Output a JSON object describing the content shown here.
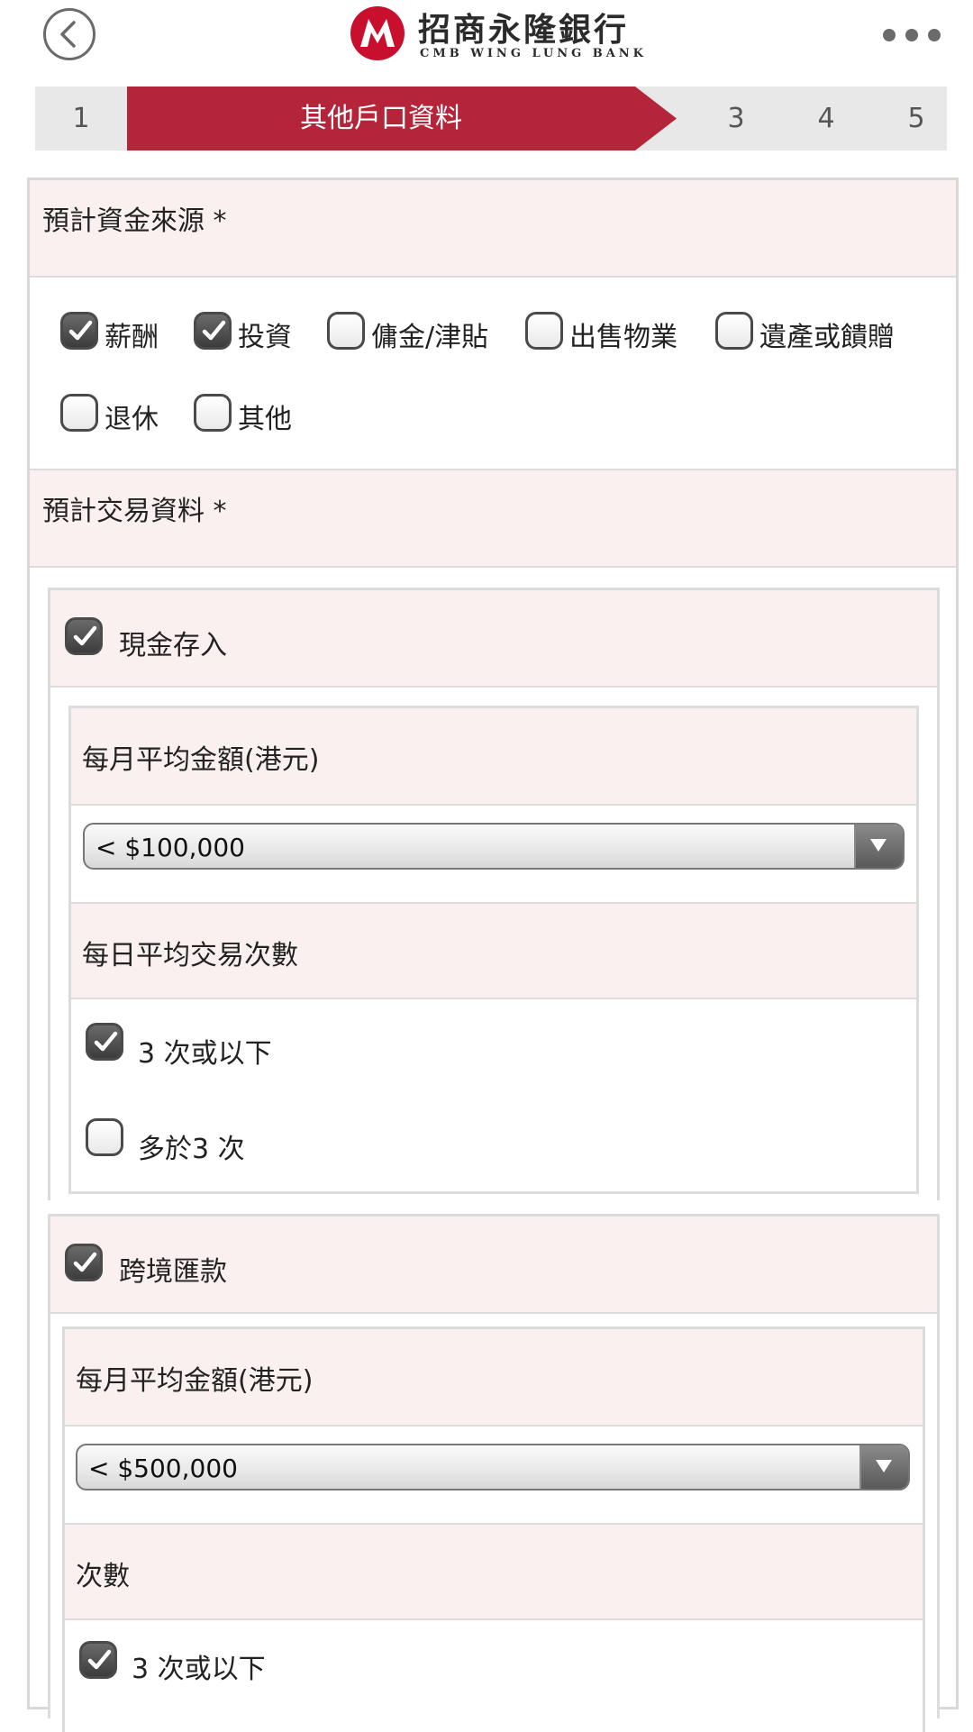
{
  "header": {
    "brand_cn": "招商永隆銀行",
    "brand_en": "CMB WING LUNG BANK",
    "brand_color": "#c8102e"
  },
  "stepper": {
    "steps": [
      "1",
      "其他戶口資料",
      "3",
      "4",
      "5"
    ],
    "current": 2,
    "active_color": "#b5253a"
  },
  "fund_source": {
    "title": "預計資金來源 *",
    "options": [
      {
        "label": "薪酬",
        "checked": true
      },
      {
        "label": "投資",
        "checked": true
      },
      {
        "label": "傭金/津貼",
        "checked": false
      },
      {
        "label": "出售物業",
        "checked": false
      },
      {
        "label": "遺產或饋贈",
        "checked": false
      },
      {
        "label": "退休",
        "checked": false
      },
      {
        "label": "其他",
        "checked": false
      }
    ]
  },
  "transactions": {
    "title": "預計交易資料 *",
    "cash_deposit": {
      "label": "現金存入",
      "checked": true,
      "monthly_amount_label": "每月平均金額(港元)",
      "monthly_amount_value": "< $100,000",
      "daily_count_label": "每日平均交易次數",
      "options": [
        {
          "label": "3 次或以下",
          "checked": true
        },
        {
          "label": "多於3 次",
          "checked": false
        }
      ]
    },
    "cross_border": {
      "label": "跨境匯款",
      "checked": true,
      "monthly_amount_label": "每月平均金額(港元)",
      "monthly_amount_value": "< $500,000",
      "count_label": "次數",
      "options": [
        {
          "label": "3 次或以下",
          "checked": true
        }
      ]
    }
  }
}
